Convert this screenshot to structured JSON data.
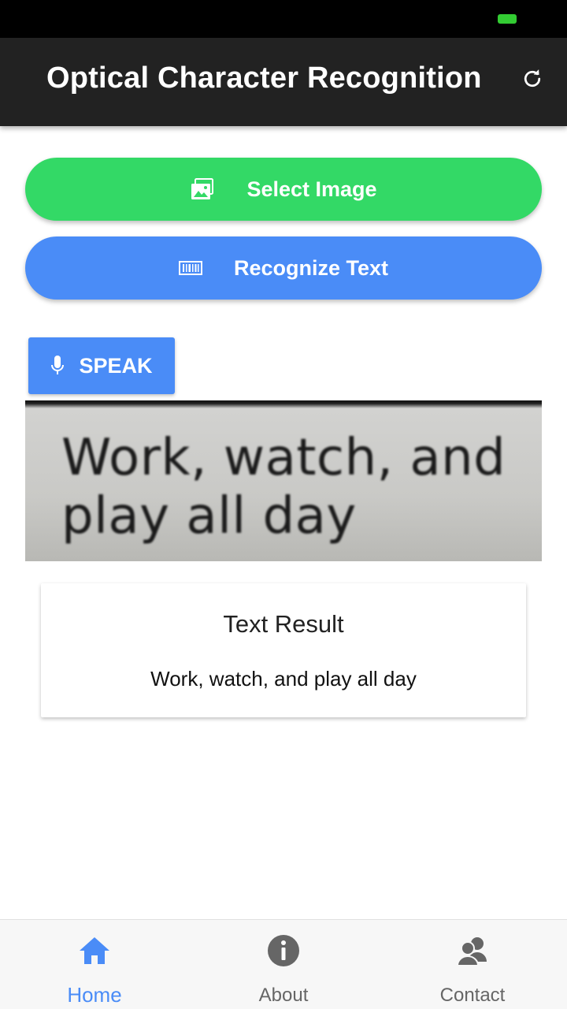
{
  "app": {
    "title": "Optical Character Recognition",
    "refresh_icon": "refresh-icon"
  },
  "actions": {
    "select_image_label": "Select Image",
    "select_image_icon": "image-icon",
    "recognize_text_label": "Recognize Text",
    "recognize_text_icon": "barcode-icon",
    "speak_label": "SPEAK",
    "speak_icon": "microphone-icon"
  },
  "preview": {
    "line1": "Work, watch, and",
    "line2": "play all day"
  },
  "result": {
    "title": "Text Result",
    "text": "Work, watch, and play all day"
  },
  "nav": {
    "items": [
      {
        "label": "Home",
        "icon": "home-icon",
        "active": true
      },
      {
        "label": "About",
        "icon": "info-icon",
        "active": false
      },
      {
        "label": "Contact",
        "icon": "contacts-icon",
        "active": false
      }
    ]
  },
  "colors": {
    "app_bar": "#222222",
    "select_button": "#33d966",
    "recognize_button": "#4a8cf7",
    "speak_button": "#4a8cf7",
    "nav_active": "#4a8cf7",
    "battery": "#33cc33"
  }
}
